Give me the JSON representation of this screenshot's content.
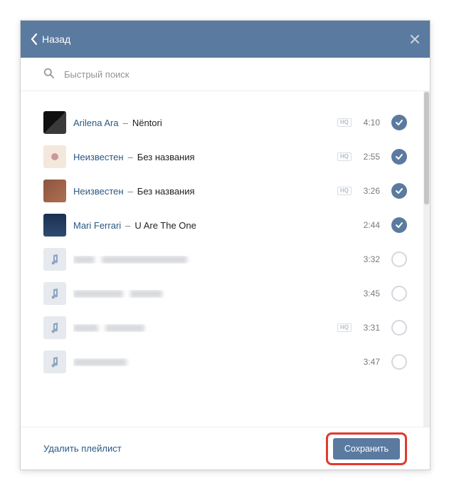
{
  "header": {
    "back_label": "Назад"
  },
  "search": {
    "placeholder": "Быстрый поиск"
  },
  "hq_label": "HQ",
  "tracks": [
    {
      "artist": "Arilena Ara",
      "title": "Nëntori",
      "duration": "4:10",
      "hq": true,
      "selected": true,
      "thumb": "img0"
    },
    {
      "artist": "Неизвестен",
      "title": "Без названия",
      "duration": "2:55",
      "hq": true,
      "selected": true,
      "thumb": "img1"
    },
    {
      "artist": "Неизвестен",
      "title": "Без названия",
      "duration": "3:26",
      "hq": true,
      "selected": true,
      "thumb": "img2"
    },
    {
      "artist": "Mari Ferrari",
      "title": "U Are The One",
      "duration": "2:44",
      "hq": false,
      "selected": true,
      "thumb": "img3"
    },
    {
      "blurred": true,
      "duration": "3:32",
      "hq": false,
      "selected": false,
      "aw": 30,
      "tw": 120
    },
    {
      "blurred": true,
      "duration": "3:45",
      "hq": false,
      "selected": false,
      "aw": 70,
      "tw": 45
    },
    {
      "blurred": true,
      "duration": "3:31",
      "hq": true,
      "selected": false,
      "aw": 35,
      "tw": 55
    },
    {
      "blurred": true,
      "duration": "3:47",
      "hq": false,
      "selected": false,
      "aw": 75,
      "tw": 0
    }
  ],
  "footer": {
    "delete_label": "Удалить плейлист",
    "save_label": "Сохранить"
  }
}
